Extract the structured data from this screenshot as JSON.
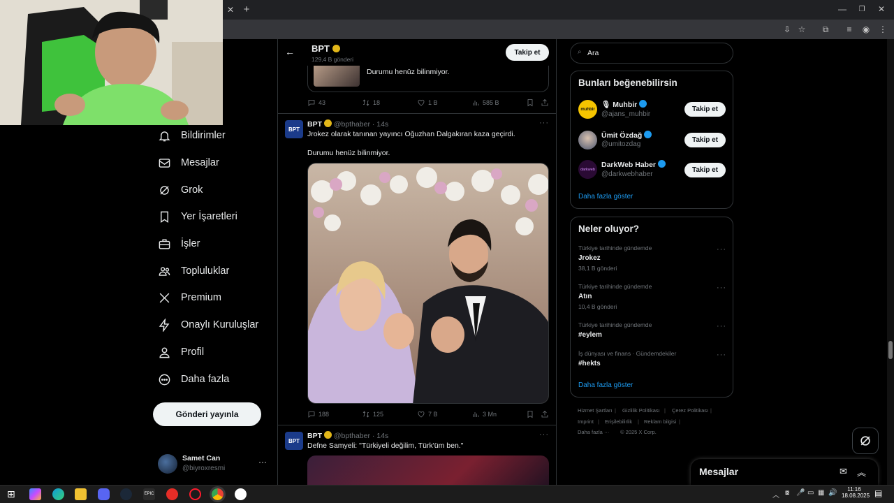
{
  "browser": {
    "tab_close": "✕",
    "new_tab": "+"
  },
  "header": {
    "name": "BPT",
    "subtitle": "129,4 B gönderi",
    "follow_label": "Takip et"
  },
  "search": {
    "placeholder": "Ara"
  },
  "nav": [
    {
      "label": "Bildirimler",
      "icon": "bell-icon"
    },
    {
      "label": "Mesajlar",
      "icon": "mail-icon"
    },
    {
      "label": "Grok",
      "icon": "grok-icon"
    },
    {
      "label": "Yer İşaretleri",
      "icon": "bookmark-icon"
    },
    {
      "label": "İşler",
      "icon": "briefcase-icon"
    },
    {
      "label": "Topluluklar",
      "icon": "communities-icon"
    },
    {
      "label": "Premium",
      "icon": "x-logo-icon"
    },
    {
      "label": "Onaylı Kuruluşlar",
      "icon": "lightning-icon"
    },
    {
      "label": "Profil",
      "icon": "person-icon"
    },
    {
      "label": "Daha fazla",
      "icon": "more-circle-icon"
    }
  ],
  "post_button": "Gönderi yayınla",
  "account": {
    "name": "Samet Can",
    "handle": "@biyroxresmi"
  },
  "top_tweet": {
    "text": "Durumu henüz bilinmiyor.",
    "replies": "43",
    "reposts": "18",
    "likes": "1 B",
    "views": "585 B"
  },
  "tweet1": {
    "name": "BPT",
    "handle": "@bpthaber",
    "time": "· 14s",
    "line1": "Jrokez olarak tanınan yayıncı Oğuzhan Dalgakıran kaza geçirdi.",
    "line2": "Durumu henüz bilinmiyor.",
    "replies": "188",
    "reposts": "125",
    "likes": "7 B",
    "views": "3 Mn"
  },
  "tweet2": {
    "name": "BPT",
    "handle": "@bpthaber",
    "time": "· 14s",
    "text": "Defne Samyeli: \"Türkiyeli değilim, Türk'üm ben.\""
  },
  "suggest": {
    "title": "Bunları beğenebilirsin",
    "users": [
      {
        "name": "Muhbir",
        "handle": "@ajans_muhbir",
        "follow": "Takip et"
      },
      {
        "name": "Ümit Özdağ",
        "handle": "@umitozdag",
        "follow": "Takip et"
      },
      {
        "name": "DarkWeb Haber",
        "handle": "@darkwebhaber",
        "follow": "Takip et"
      }
    ],
    "more": "Daha fazla göster"
  },
  "trends": {
    "title": "Neler oluyor?",
    "items": [
      {
        "meta": "Türkiye tarihinde gündemde",
        "title": "Jrokez",
        "count": "38,1 B gönderi"
      },
      {
        "meta": "Türkiye tarihinde gündemde",
        "title": "Atın",
        "count": "10,4 B gönderi"
      },
      {
        "meta": "Türkiye tarihinde gündemde",
        "title": "#eylem",
        "count": ""
      },
      {
        "meta": "İş dünyası ve finans · Gündemdekiler",
        "title": "#hekts",
        "count": ""
      }
    ],
    "more": "Daha fazla göster"
  },
  "footer": {
    "links": [
      "Hizmet Şartları",
      "Gizlilik Politikası",
      "Çerez Politikası",
      "Imprint",
      "Erişilebilirlik",
      "Reklam bilgisi",
      "Daha fazla ···",
      "© 2025 X Corp."
    ]
  },
  "messages_dock": {
    "title": "Mesajlar"
  },
  "taskbar": {
    "time": "11:16",
    "date": "18.08.2025"
  },
  "colors": {
    "verified_gold": "#e2b719",
    "verified_blue": "#1d9bf0",
    "link_blue": "#1d9bf0"
  }
}
